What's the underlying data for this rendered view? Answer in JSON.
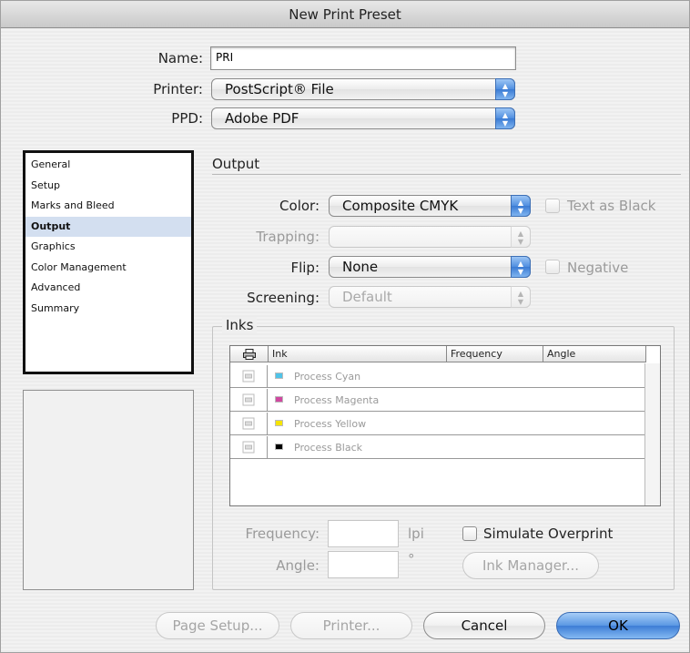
{
  "window": {
    "title": "New Print Preset"
  },
  "header": {
    "name_label": "Name:",
    "name_value": "PRI",
    "printer_label": "Printer:",
    "printer_value": "PostScript® File",
    "ppd_label": "PPD:",
    "ppd_value": "Adobe PDF"
  },
  "sidebar": {
    "items": [
      {
        "label": "General"
      },
      {
        "label": "Setup"
      },
      {
        "label": "Marks and Bleed"
      },
      {
        "label": "Output",
        "selected": true
      },
      {
        "label": "Graphics"
      },
      {
        "label": "Color Management"
      },
      {
        "label": "Advanced"
      },
      {
        "label": "Summary"
      }
    ]
  },
  "output": {
    "section_title": "Output",
    "color_label": "Color:",
    "color_value": "Composite CMYK",
    "text_as_black_label": "Text as Black",
    "trapping_label": "Trapping:",
    "trapping_value": "",
    "flip_label": "Flip:",
    "flip_value": "None",
    "negative_label": "Negative",
    "screening_label": "Screening:",
    "screening_value": "Default"
  },
  "inks": {
    "group_label": "Inks",
    "columns": [
      "Ink",
      "Frequency",
      "Angle"
    ],
    "rows": [
      {
        "name": "Process Cyan",
        "color": "#4fc3e8"
      },
      {
        "name": "Process Magenta",
        "color": "#d048a0"
      },
      {
        "name": "Process Yellow",
        "color": "#f5e400"
      },
      {
        "name": "Process Black",
        "color": "#000000"
      }
    ],
    "frequency_label": "Frequency:",
    "frequency_value": "",
    "frequency_unit": "lpi",
    "angle_label": "Angle:",
    "angle_value": "",
    "angle_unit": "°",
    "simulate_overprint_label": "Simulate Overprint",
    "ink_manager_label": "Ink Manager..."
  },
  "footer": {
    "page_setup_label": "Page Setup...",
    "printer_label": "Printer...",
    "cancel_label": "Cancel",
    "ok_label": "OK"
  },
  "colors": {
    "accent": "#4f8fe0",
    "selection": "#d3dff0"
  }
}
